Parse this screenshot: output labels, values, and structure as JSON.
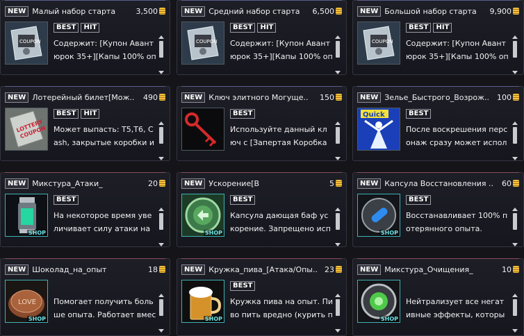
{
  "new_label": "NEW",
  "shop_label": "SHOP",
  "cards": [
    {
      "name": "Малый набор старта",
      "price": "3,500",
      "badges": [
        "BEST",
        "HIT"
      ],
      "desc": "Содержит: [Купон Авантюрок 35+][Капы 100% опыт",
      "icon": "coupon-bag-icon"
    },
    {
      "name": "Средний набор старта",
      "price": "6,500",
      "badges": [
        "BEST",
        "HIT"
      ],
      "desc": "Содержит: [Купон Авантюрок 35+][Капы 100% опыт",
      "icon": "coupon-bag-icon"
    },
    {
      "name": "Большой набор старта",
      "price": "9,900",
      "badges": [
        "BEST",
        "HIT"
      ],
      "desc": "Содержит: [Купон Авантюрок 35+][Капы 100% опыт",
      "icon": "coupon-bag-icon"
    },
    {
      "name": "Лотерейный билет[Мож..",
      "price": "490",
      "badges": [
        "BEST",
        "HIT"
      ],
      "desc": "Может выпасть: T5,T6, Cash, закрытые коробки и кл",
      "icon": "lottery-coupon-icon"
    },
    {
      "name": "Ключ элитного Могуще..",
      "price": "150",
      "badges": [
        "BEST"
      ],
      "desc": "Используйте данный ключ с [Запертая Коробка Мо",
      "icon": "red-key-icon"
    },
    {
      "name": "Зелье_Быстрого_Возрож..",
      "price": "100",
      "badges": [
        "BEST"
      ],
      "desc": "После воскрешения персонаж сразу может исполь",
      "icon": "quick-revive-icon"
    },
    {
      "name": "Микстура_Атаки_",
      "price": "20",
      "badges": [
        "BEST"
      ],
      "desc": "На некоторое время увеличивает силу атаки на 55",
      "icon": "attack-potion-icon"
    },
    {
      "name": "Ускорение[В",
      "price": "5",
      "badges": [
        "BEST"
      ],
      "desc": "Капсула дающая баф ускорение. Запрещено исполь",
      "icon": "speed-capsule-icon"
    },
    {
      "name": "Капсула Восстановления ..",
      "price": "60",
      "badges": [
        "BEST"
      ],
      "desc": "Восстанавливает 100% потерянного опыта.",
      "icon": "recovery-capsule-icon"
    },
    {
      "name": "Шоколад_на_опыт",
      "price": "18",
      "badges": [],
      "desc": "Помогает получить больше опыта. Работает вмест",
      "icon": "chocolate-icon"
    },
    {
      "name": "Кружка_пива_[Атака/Опы..",
      "price": "23",
      "badges": [
        "BEST"
      ],
      "desc": "Кружка пива на опыт. Пиво пить вредно (курить про",
      "icon": "beer-mug-icon"
    },
    {
      "name": "Микстура_Очищения_",
      "price": "10",
      "badges": [],
      "desc": "Нейтрализует все негативные эффекты, которые б",
      "icon": "cleanse-potion-icon"
    }
  ]
}
